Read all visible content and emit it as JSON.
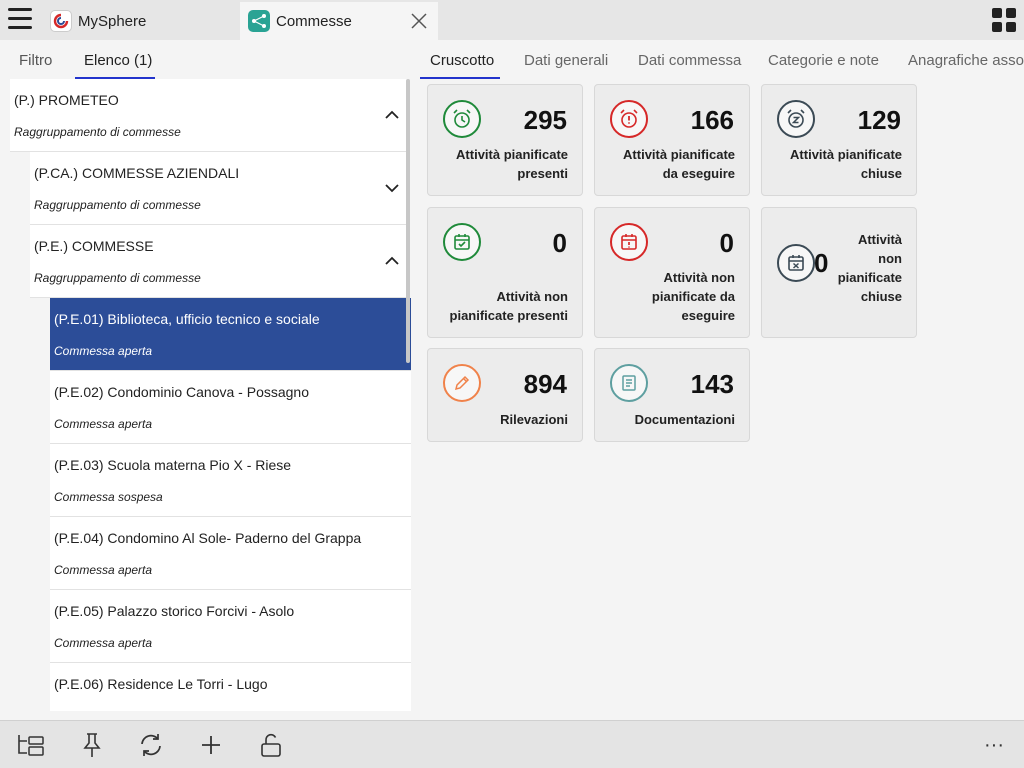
{
  "app": {
    "tabs": [
      {
        "label": "MySphere"
      },
      {
        "label": "Commesse"
      }
    ]
  },
  "left_tabs": [
    {
      "label": "Filtro"
    },
    {
      "label": "Elenco (1)"
    }
  ],
  "list": [
    {
      "title": "(P.) PROMETEO",
      "subtitle": "Raggruppamento di commesse",
      "expanded": true
    },
    {
      "title": "(P.CA.) COMMESSE AZIENDALI",
      "subtitle": "Raggruppamento di commesse",
      "expanded": false
    },
    {
      "title": "(P.E.) COMMESSE",
      "subtitle": "Raggruppamento di commesse",
      "expanded": true
    },
    {
      "title": "(P.E.01) Biblioteca, ufficio tecnico e sociale",
      "subtitle": "Commessa aperta",
      "selected": true
    },
    {
      "title": "(P.E.02) Condominio Canova - Possagno",
      "subtitle": "Commessa aperta"
    },
    {
      "title": "(P.E.03) Scuola materna Pio X - Riese",
      "subtitle": "Commessa sospesa"
    },
    {
      "title": "(P.E.04) Condomino Al Sole- Paderno del Grappa",
      "subtitle": "Commessa aperta"
    },
    {
      "title": "(P.E.05) Palazzo storico Forcivi - Asolo",
      "subtitle": "Commessa aperta"
    },
    {
      "title": "(P.E.06) Residence Le Torri - Lugo",
      "subtitle": ""
    }
  ],
  "right_tabs": [
    {
      "label": "Cruscotto"
    },
    {
      "label": "Dati generali"
    },
    {
      "label": "Dati commessa"
    },
    {
      "label": "Categorie e note"
    },
    {
      "label": "Anagrafiche asso"
    }
  ],
  "cards": [
    {
      "value": "295",
      "label_1": "Attività pianificate",
      "label_2": "presenti",
      "icon": "alarm-clock-icon",
      "color": "#1f8a3a"
    },
    {
      "value": "166",
      "label_1": "Attività pianificate",
      "label_2": "da eseguire",
      "icon": "alarm-alert-icon",
      "color": "#d62828"
    },
    {
      "value": "129",
      "label_1": "Attività pianificate",
      "label_2": "chiuse",
      "icon": "alarm-snooze-icon",
      "color": "#3b4a55"
    },
    {
      "value": "0",
      "label_1": "Attività non",
      "label_2": "pianificate presenti",
      "icon": "calendar-check-icon",
      "color": "#1f8a3a"
    },
    {
      "value": "0",
      "label_1": "Attività non",
      "label_2": "pianificate da",
      "label_3": "eseguire",
      "icon": "calendar-alert-icon",
      "color": "#d62828"
    },
    {
      "value": "0",
      "label_1": "Attività",
      "label_2": "non",
      "label_3": "pianificate",
      "label_4": "chiuse",
      "icon": "calendar-x-icon",
      "color": "#3b4a55"
    },
    {
      "value": "894",
      "label_1": "Rilevazioni",
      "icon": "pencil-icon",
      "color": "#f0824a"
    },
    {
      "value": "143",
      "label_1": "Documentazioni",
      "icon": "document-icon",
      "color": "#5e9fa0"
    }
  ],
  "toolbar": {
    "more_label": "···"
  }
}
